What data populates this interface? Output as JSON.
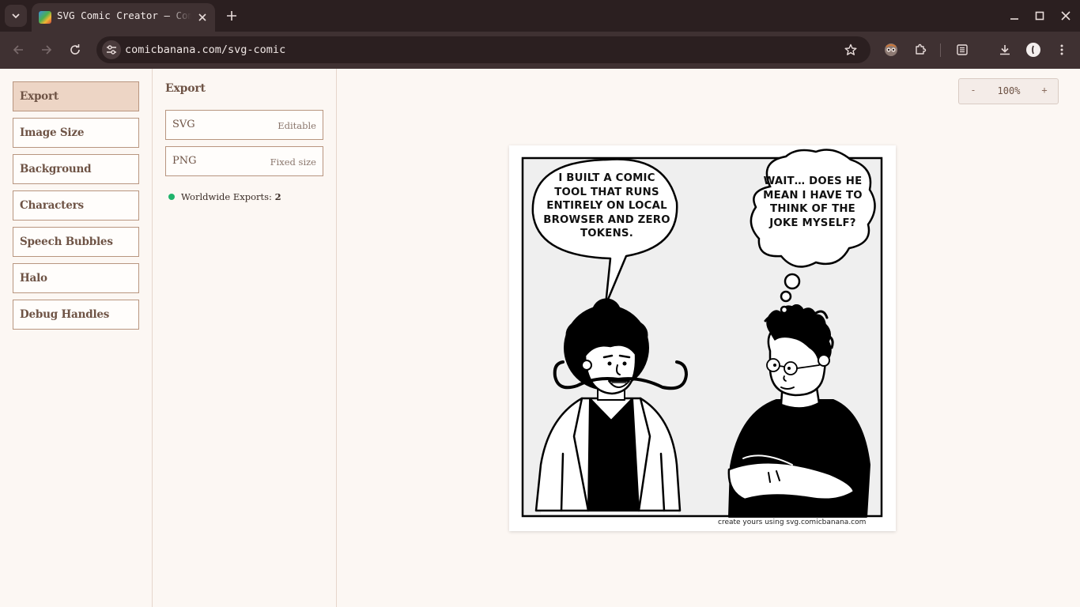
{
  "browser": {
    "tab_title": "SVG Comic Creator – Comic Banana",
    "url": "comicbanana.com/svg-comic",
    "icons": {
      "tab_search": "chevron-down-icon",
      "tab_close": "close-icon",
      "new_tab": "plus-icon",
      "back": "arrow-left-icon",
      "forward": "arrow-right-icon",
      "reload": "reload-icon",
      "site_info": "tune-icon",
      "bookmark": "star-icon",
      "extensions": "puzzle-icon",
      "reading_list": "sidepanel-icon",
      "downloads": "download-icon",
      "menu": "kebab-menu-icon"
    }
  },
  "sidebar": {
    "items": [
      {
        "label": "Export",
        "active": true
      },
      {
        "label": "Image Size"
      },
      {
        "label": "Background"
      },
      {
        "label": "Characters"
      },
      {
        "label": "Speech Bubbles"
      },
      {
        "label": "Halo"
      },
      {
        "label": "Debug Handles"
      }
    ]
  },
  "panel": {
    "title": "Export",
    "options": [
      {
        "name": "SVG",
        "note": "Editable"
      },
      {
        "name": "PNG",
        "note": "Fixed size"
      }
    ],
    "stat_label": "Worldwide Exports:",
    "stat_value": "2"
  },
  "zoom": {
    "minus": "-",
    "value": "100%",
    "plus": "+"
  },
  "comic": {
    "speech_bubble": "I BUILT A COMIC TOOL THAT RUNS ENTIRELY ON LOCAL BROWSER AND ZERO TOKENS.",
    "thought_bubble": "WAIT… DOES HE MEAN I HAVE TO THINK OF THE JOKE MYSELF?",
    "watermark": "create yours using svg.comicbanana.com"
  },
  "colors": {
    "accent": "#edd5c5",
    "border": "#b8957f",
    "text": "#6e5345",
    "status_dot": "#1fb36b"
  }
}
